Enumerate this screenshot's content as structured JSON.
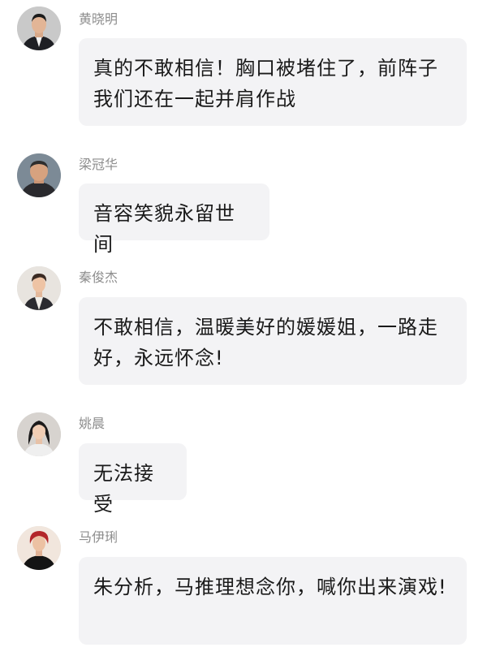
{
  "messages": [
    {
      "sender": "黄晓明",
      "text": "真的不敢相信！胸口被堵住了，前阵子我们还在一起并肩作战",
      "avatar_icon": "man-in-suit-avatar"
    },
    {
      "sender": "梁冠华",
      "text": "音容笑貌永留世间",
      "avatar_icon": "older-man-avatar"
    },
    {
      "sender": "秦俊杰",
      "text": "不敢相信，温暖美好的媛媛姐，一路走好，永远怀念!",
      "avatar_icon": "young-man-avatar"
    },
    {
      "sender": "姚晨",
      "text": "无法接受",
      "avatar_icon": "woman-avatar"
    },
    {
      "sender": "马伊琍",
      "text": "朱分析，马推理想念你，喊你出来演戏!",
      "avatar_icon": "woman-red-hair-avatar"
    }
  ]
}
